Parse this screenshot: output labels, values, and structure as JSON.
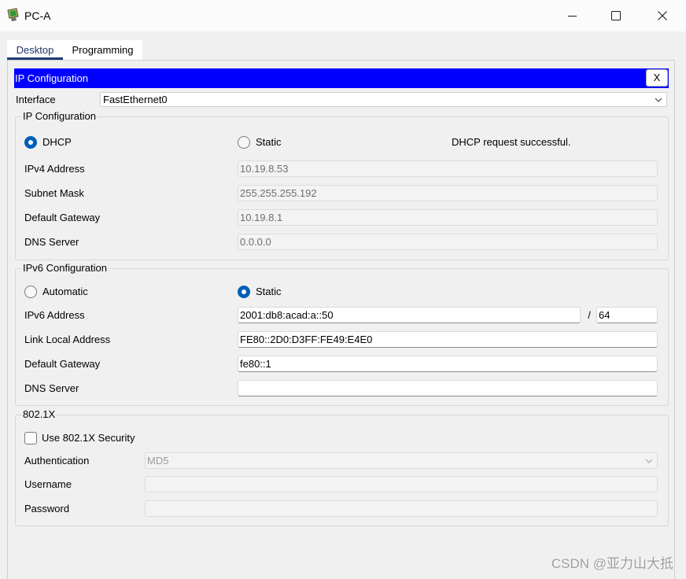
{
  "window": {
    "title": "PC-A",
    "app_icon": "pc-device-icon",
    "controls": [
      "minimize-icon",
      "maximize-icon",
      "close-icon"
    ]
  },
  "tabs": [
    {
      "label": "Desktop",
      "selected": true
    },
    {
      "label": "Programming",
      "selected": false
    }
  ],
  "dialog": {
    "title": "IP Configuration",
    "close_label": "X"
  },
  "interface": {
    "label": "Interface",
    "value": "FastEthernet0"
  },
  "ipv4": {
    "group_label": "IP Configuration",
    "modes": [
      {
        "label": "DHCP",
        "checked": true
      },
      {
        "label": "Static",
        "checked": false
      }
    ],
    "status": "DHCP request successful.",
    "fields": [
      {
        "label": "IPv4 Address",
        "value": "10.19.8.53",
        "enabled": false
      },
      {
        "label": "Subnet Mask",
        "value": "255.255.255.192",
        "enabled": false
      },
      {
        "label": "Default Gateway",
        "value": "10.19.8.1",
        "enabled": false
      },
      {
        "label": "DNS Server",
        "value": "0.0.0.0",
        "enabled": false
      }
    ]
  },
  "ipv6": {
    "group_label": "IPv6 Configuration",
    "modes": [
      {
        "label": "Automatic",
        "checked": false
      },
      {
        "label": "Static",
        "checked": true
      }
    ],
    "address": {
      "label": "IPv6 Address",
      "value": "2001:db8:acad:a::50",
      "separator": "/",
      "prefix": "64",
      "enabled": true
    },
    "link_local": {
      "label": "Link Local Address",
      "value": "FE80::2D0:D3FF:FE49:E4E0",
      "enabled": true
    },
    "gateway": {
      "label": "Default Gateway",
      "value": "fe80::1",
      "enabled": true
    },
    "dns": {
      "label": "DNS Server",
      "value": "",
      "enabled": true
    }
  },
  "dot1x": {
    "group_label": "802.1X",
    "use_security": {
      "label": "Use 802.1X Security",
      "checked": false
    },
    "authentication": {
      "label": "Authentication",
      "value": "MD5",
      "enabled": false
    },
    "username": {
      "label": "Username",
      "value": "",
      "enabled": false
    },
    "password": {
      "label": "Password",
      "value": "",
      "enabled": false
    }
  },
  "watermark": "CSDN @亚力山大抵",
  "colors": {
    "header": "#0000ff",
    "accent": "#005fb8",
    "tab_underline": "#1e3a70"
  }
}
